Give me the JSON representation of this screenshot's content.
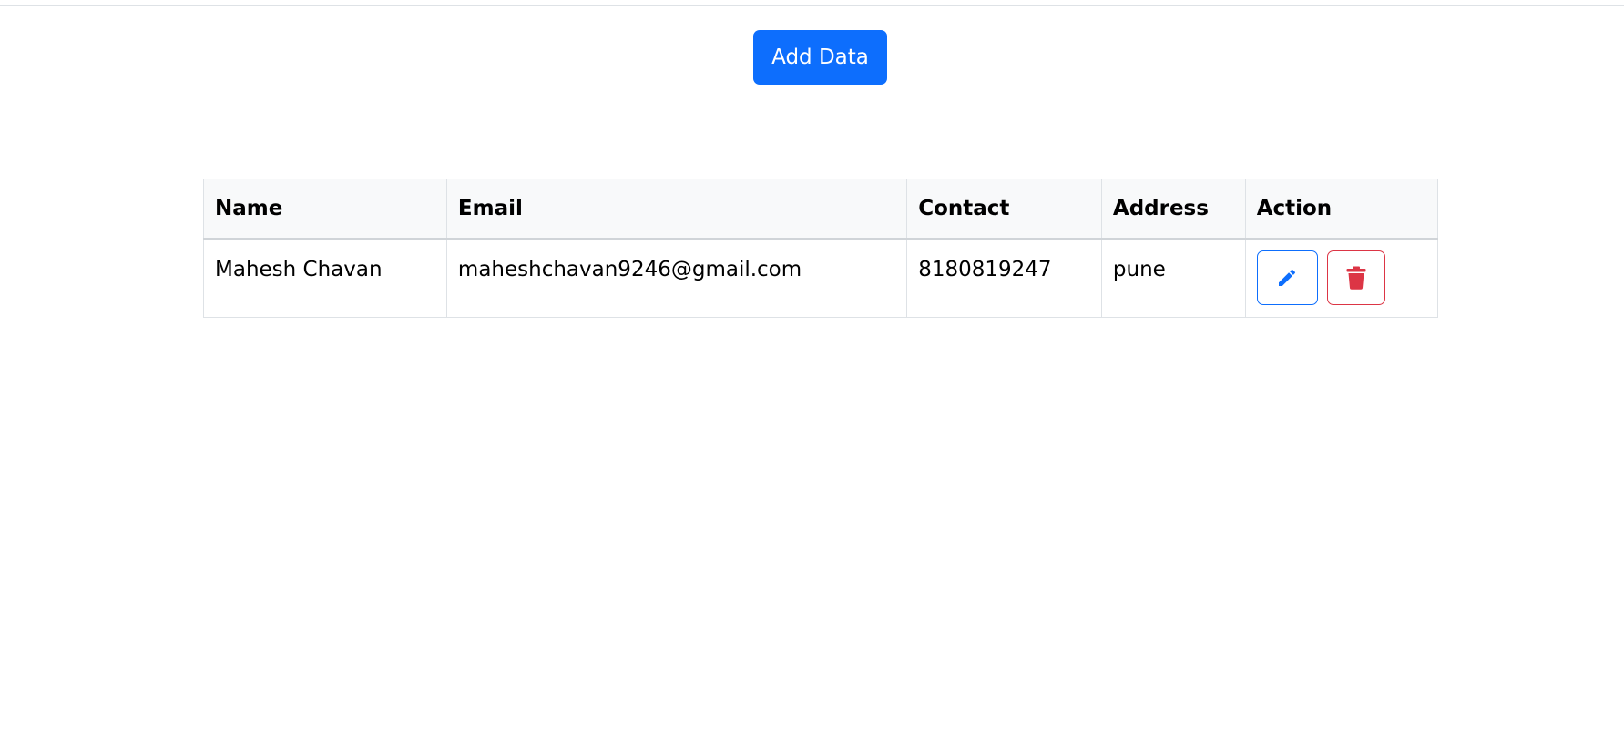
{
  "toolbar": {
    "add_label": "Add Data"
  },
  "table": {
    "headers": {
      "name": "Name",
      "email": "Email",
      "contact": "Contact",
      "address": "Address",
      "action": "Action"
    },
    "rows": [
      {
        "name": "Mahesh Chavan",
        "email": "maheshchavan9246@gmail.com",
        "contact": "8180819247",
        "address": "pune",
        "actions": {
          "edit_icon": "pencil-icon",
          "delete_icon": "trash-icon"
        }
      }
    ]
  },
  "colors": {
    "primary": "#0d6efd",
    "danger": "#dc3545",
    "header_bg": "#f8f9fa",
    "border": "#dee2e6"
  }
}
